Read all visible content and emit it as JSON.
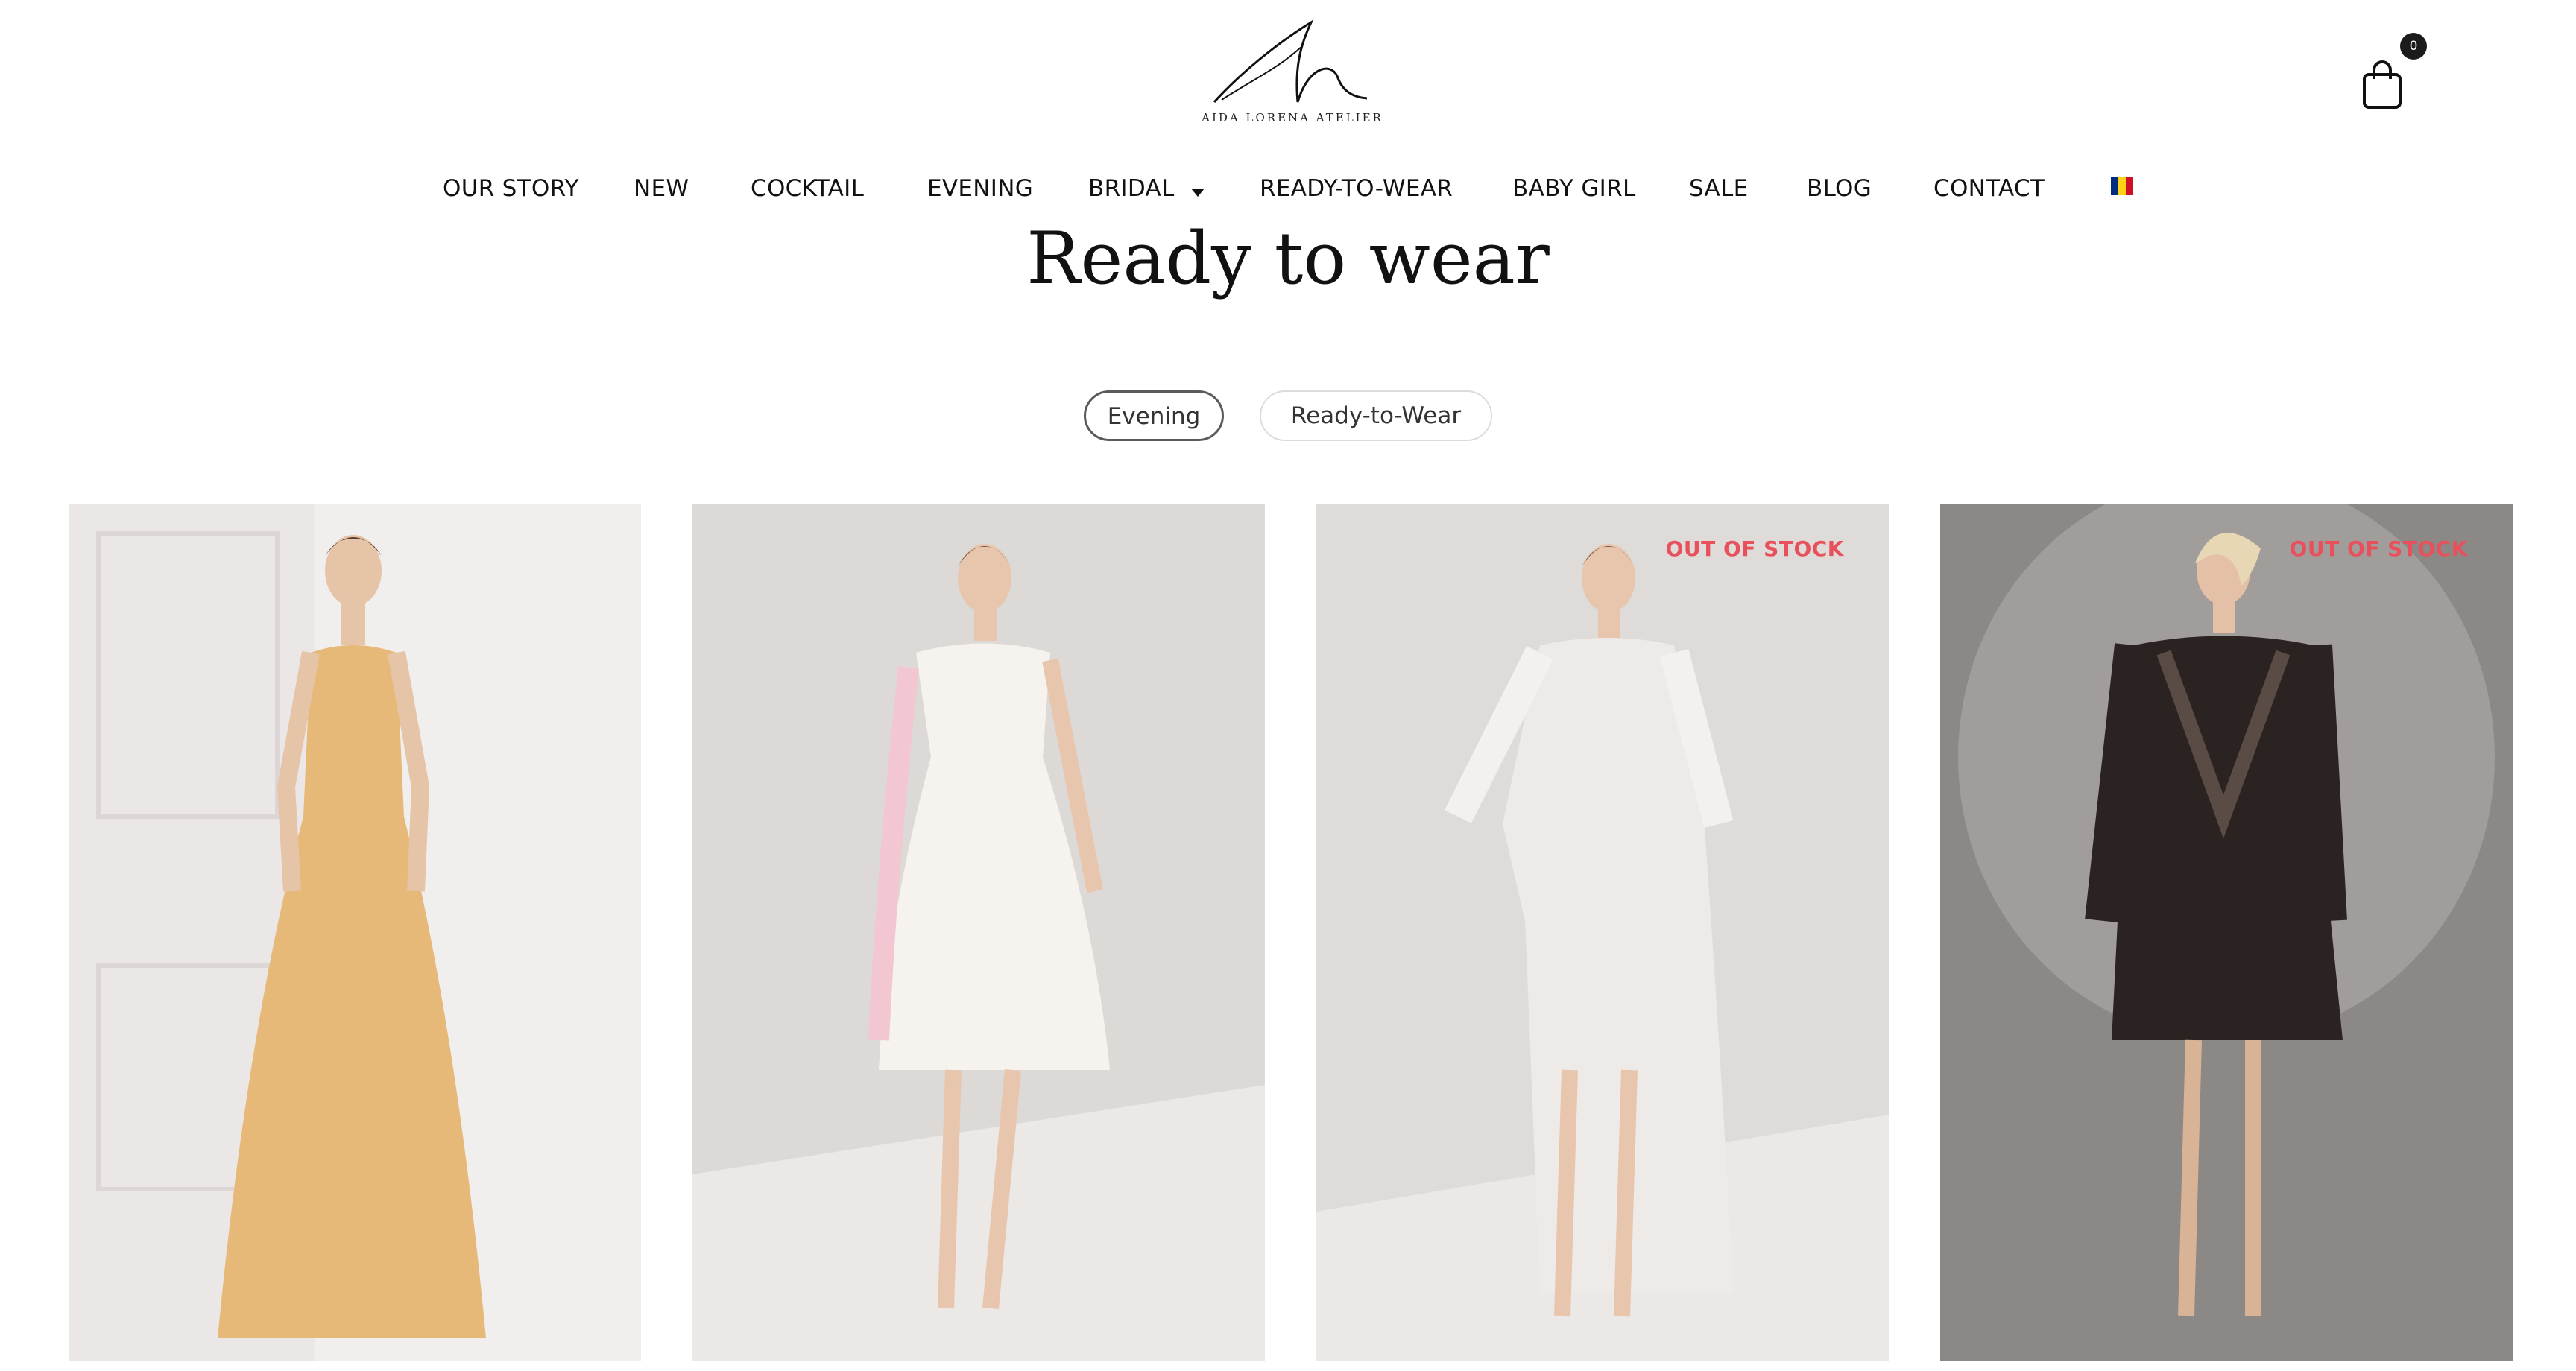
{
  "brand": {
    "logo_text": "AIDA LORENA ATELIER"
  },
  "cart": {
    "count": "0"
  },
  "nav": [
    {
      "label": "OUR STORY"
    },
    {
      "label": "NEW"
    },
    {
      "label": "COCKTAIL"
    },
    {
      "label": "EVENING"
    },
    {
      "label": "BRIDAL"
    },
    {
      "label": "READY-TO-WEAR"
    },
    {
      "label": "BABY GIRL"
    },
    {
      "label": "SALE"
    },
    {
      "label": "BLOG"
    },
    {
      "label": "CONTACT"
    }
  ],
  "language_flag": {
    "icon": "romania-flag-icon",
    "colors": [
      "#002B7F",
      "#FCD116",
      "#CE1126"
    ]
  },
  "page": {
    "title": "Ready to wear"
  },
  "filters": [
    {
      "label": "Evening",
      "active": true
    },
    {
      "label": "Ready-to-Wear",
      "active": false
    }
  ],
  "products": [
    {
      "badge": "",
      "background": "#f1eeee",
      "dress_color": "#e6b978"
    },
    {
      "badge": "",
      "background": "#dcd9d7",
      "dress_color": "#f6f3ef"
    },
    {
      "badge": "OUT OF STOCK",
      "background": "#dedbd9",
      "dress_color": "#eeeae7"
    },
    {
      "badge": "OUT OF STOCK",
      "background": "#8b8886",
      "dress_color": "#2b2322"
    }
  ],
  "colors": {
    "badge": "#e8505b",
    "text": "#111111"
  }
}
